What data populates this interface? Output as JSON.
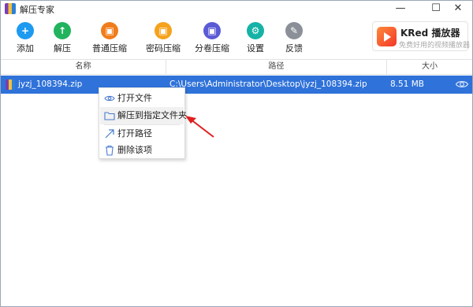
{
  "window": {
    "title": "解压专家",
    "controls": [
      "—",
      "☐",
      "✕"
    ]
  },
  "toolbar": {
    "items": [
      {
        "label": "添加",
        "icon": "add-icon",
        "color": "#1e9af0",
        "glyph": "+"
      },
      {
        "label": "解压",
        "icon": "extract-icon",
        "color": "#22b35e",
        "glyph": "↑"
      },
      {
        "label": "普通压缩",
        "icon": "compress-icon",
        "color": "#f07d1b",
        "glyph": "▣"
      },
      {
        "label": "密码压缩",
        "icon": "password-compress-icon",
        "color": "#f5a21c",
        "glyph": "▣"
      },
      {
        "label": "分卷压缩",
        "icon": "split-compress-icon",
        "color": "#5b5bd6",
        "glyph": "▣"
      },
      {
        "label": "设置",
        "icon": "settings-icon",
        "color": "#16b2a6",
        "glyph": "⚙"
      },
      {
        "label": "反馈",
        "icon": "feedback-icon",
        "color": "#8a8f98",
        "glyph": "✎"
      }
    ]
  },
  "brand": {
    "name": "KRed 播放器",
    "tagline": "免费好用的视频播放器"
  },
  "table": {
    "headers": {
      "name": "名称",
      "path": "路径",
      "size": "大小"
    },
    "rows": [
      {
        "name": "jyzj_108394.zip",
        "path": "C:\\Users\\Administrator\\Desktop\\jyzj_108394.zip",
        "size": "8.51 MB"
      }
    ]
  },
  "context_menu": {
    "items": [
      {
        "label": "打开文件",
        "icon": "eye-icon"
      },
      {
        "label": "解压到指定文件夹",
        "icon": "folder-icon"
      },
      {
        "label": "打开路径",
        "icon": "arrow-up-right-icon"
      },
      {
        "label": "删除该项",
        "icon": "trash-icon"
      }
    ]
  },
  "colors": {
    "selected_row": "#2f72d9",
    "annotation_arrow": "#e02020"
  }
}
